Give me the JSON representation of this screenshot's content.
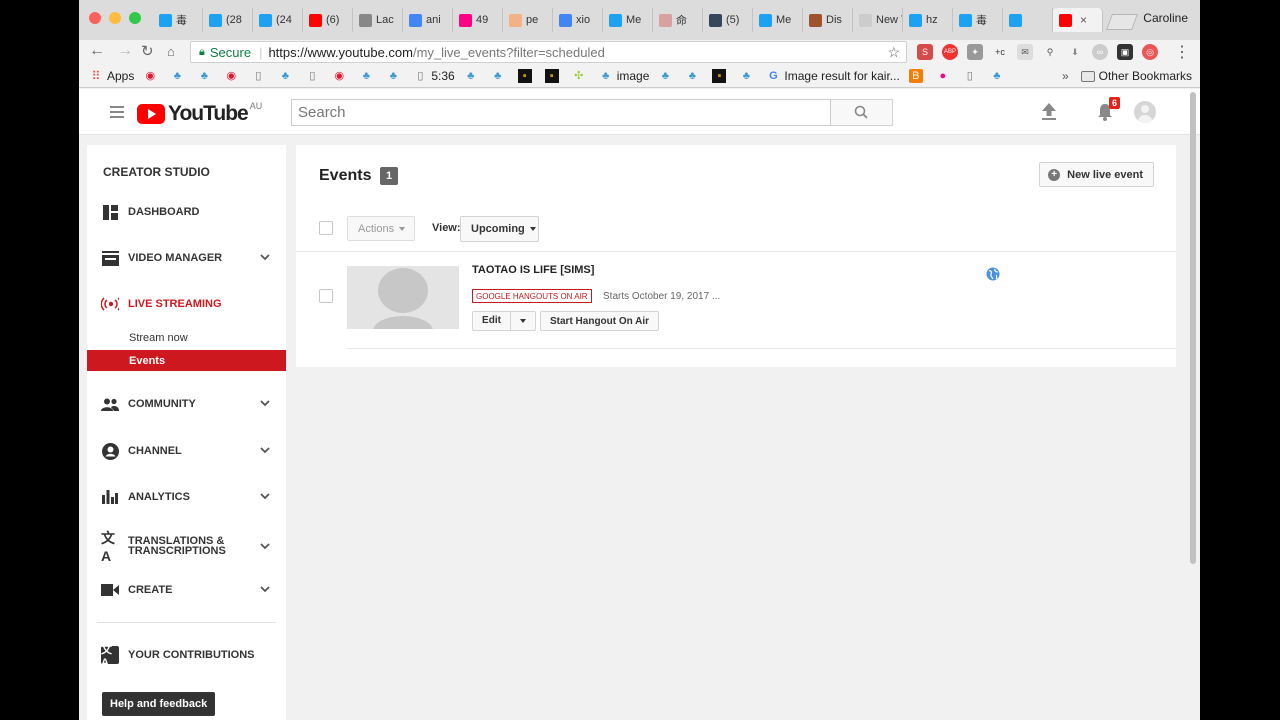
{
  "browser": {
    "profile": "Caroline",
    "tabs": [
      {
        "label": "毒",
        "icon": "twitter-icon",
        "color": "#1da1f2"
      },
      {
        "label": "(28",
        "icon": "twitter-icon",
        "color": "#1da1f2"
      },
      {
        "label": "(24",
        "icon": "twitter-icon",
        "color": "#1da1f2"
      },
      {
        "label": "(6)",
        "icon": "youtube-icon",
        "color": "#ff0000"
      },
      {
        "label": "Lac",
        "icon": "apple-icon",
        "color": "#888888"
      },
      {
        "label": "ani",
        "icon": "google-icon",
        "color": "#4285f4"
      },
      {
        "label": "49",
        "icon": "flickr-icon",
        "color": "#ff0084"
      },
      {
        "label": "pe",
        "icon": "anime-icon",
        "color": "#f4b183"
      },
      {
        "label": "xio",
        "icon": "google-icon",
        "color": "#4285f4"
      },
      {
        "label": "Me",
        "icon": "twitter-icon",
        "color": "#1da1f2"
      },
      {
        "label": "命",
        "icon": "image-icon",
        "color": "#d9a0a0"
      },
      {
        "label": "(5)",
        "icon": "tumblr-icon",
        "color": "#36465d"
      },
      {
        "label": "Me",
        "icon": "twitter-icon",
        "color": "#1da1f2"
      },
      {
        "label": "Dis",
        "icon": "anime-icon",
        "color": "#a0522d"
      },
      {
        "label": "New T",
        "icon": "blank-icon",
        "color": "#cccccc"
      },
      {
        "label": "hz",
        "icon": "twitter-icon",
        "color": "#1da1f2"
      },
      {
        "label": "毒",
        "icon": "twitter-icon",
        "color": "#1da1f2"
      },
      {
        "label": "",
        "icon": "twitter-icon",
        "color": "#1da1f2"
      },
      {
        "label": "",
        "icon": "youtube-icon",
        "color": "#ff0000",
        "active": true
      }
    ],
    "address": {
      "secure_label": "Secure",
      "url_host": "https://www.youtube.com",
      "url_path": "/my_live_events?filter=scheduled"
    },
    "bookmarks": {
      "apps": "Apps",
      "time": "5:36",
      "image": "image",
      "image_result": "Image result for kair...",
      "other": "Other Bookmarks"
    }
  },
  "youtube": {
    "country": "AU",
    "search_placeholder": "Search",
    "notification_count": "6"
  },
  "sidebar": {
    "title": "CREATOR STUDIO",
    "items": {
      "dashboard": "DASHBOARD",
      "video_manager": "VIDEO MANAGER",
      "live_streaming": "LIVE STREAMING",
      "stream_now": "Stream now",
      "events": "Events",
      "community": "COMMUNITY",
      "channel": "CHANNEL",
      "analytics": "ANALYTICS",
      "translations_1": "TRANSLATIONS &",
      "translations_2": "TRANSCRIPTIONS",
      "create": "CREATE",
      "contributions": "YOUR CONTRIBUTIONS"
    },
    "help": "Help and feedback"
  },
  "main": {
    "title": "Events",
    "count": "1",
    "new_event": "New live event",
    "actions": "Actions",
    "view_label": "View:",
    "view_value": "Upcoming",
    "event": {
      "name": "TAOTAO IS LIFE [SIMS]",
      "badge": "GOOGLE HANGOUTS ON AIR",
      "starts": "Starts October 19, 2017 ...",
      "edit": "Edit",
      "start_hangout": "Start Hangout On Air"
    }
  }
}
